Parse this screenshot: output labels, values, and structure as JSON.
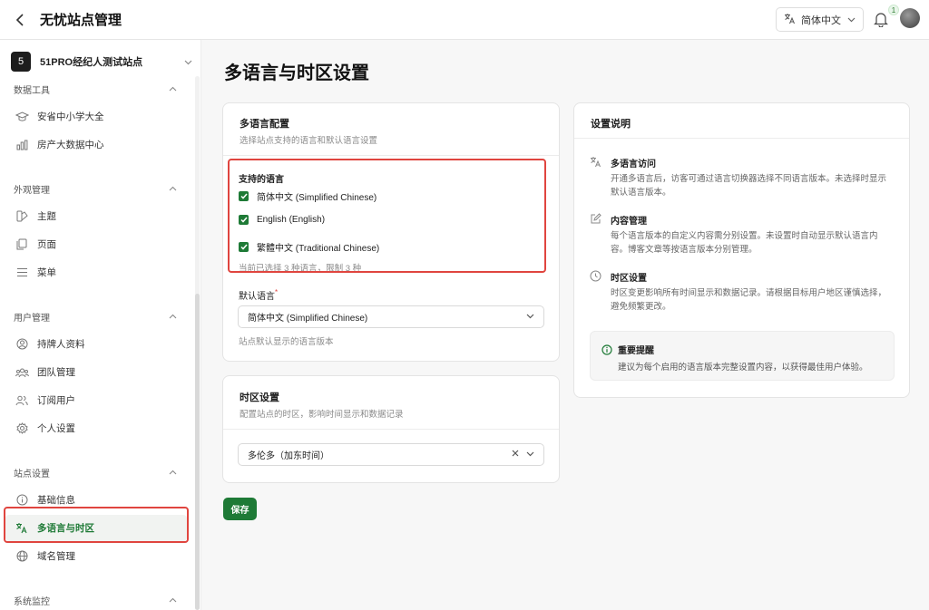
{
  "header": {
    "title": "无忧站点管理",
    "lang_label": "简体中文",
    "notification_count": "1"
  },
  "sidebar": {
    "site_badge": "5",
    "site_name": "51PRO经纪人测试站点",
    "groups": {
      "data_tools": "数据工具",
      "appearance": "外观管理",
      "users": "用户管理",
      "site_settings": "站点设置",
      "monitoring": "系统监控"
    },
    "items": {
      "schools": "安省中小学大全",
      "realestate": "房产大数据中心",
      "theme": "主题",
      "pages": "页面",
      "menu": "菜单",
      "license_info": "持牌人资料",
      "team": "团队管理",
      "subscribers": "订阅用户",
      "personal": "个人设置",
      "basic": "基础信息",
      "i18n": "多语言与时区",
      "domain": "域名管理"
    }
  },
  "main": {
    "page_title": "多语言与时区设置",
    "lang_card": {
      "title": "多语言配置",
      "subtitle": "选择站点支持的语言和默认语言设置",
      "supported_label": "支持的语言",
      "languages": [
        "简体中文 (Simplified Chinese)",
        "English (English)",
        "繁體中文 (Traditional Chinese)"
      ],
      "count_text": "当前已选择 3 种语言，限制 3 种",
      "default_label": "默认语言",
      "required_mark": "*",
      "default_value": "简体中文 (Simplified Chinese)",
      "default_hint": "站点默认显示的语言版本"
    },
    "tz_card": {
      "title": "时区设置",
      "subtitle": "配置站点的时区，影响时间显示和数据记录",
      "value": "多伦多（加东时间）"
    },
    "save_label": "保存"
  },
  "info": {
    "title": "设置说明",
    "items": [
      {
        "title": "多语言访问",
        "desc": "开通多语言后，访客可通过语言切换器选择不同语言版本。未选择时显示默认语言版本。"
      },
      {
        "title": "内容管理",
        "desc": "每个语言版本的自定义内容需分别设置。未设置时自动显示默认语言内容。博客文章等按语言版本分别管理。"
      },
      {
        "title": "时区设置",
        "desc": "时区变更影响所有时间显示和数据记录。请根据目标用户地区谨慎选择，避免频繁更改。"
      }
    ],
    "notice_title": "重要提醒",
    "notice_text": "建议为每个启用的语言版本完整设置内容，以获得最佳用户体验。"
  },
  "colors": {
    "accent": "#1e7a36",
    "highlight": "#e0453f"
  }
}
